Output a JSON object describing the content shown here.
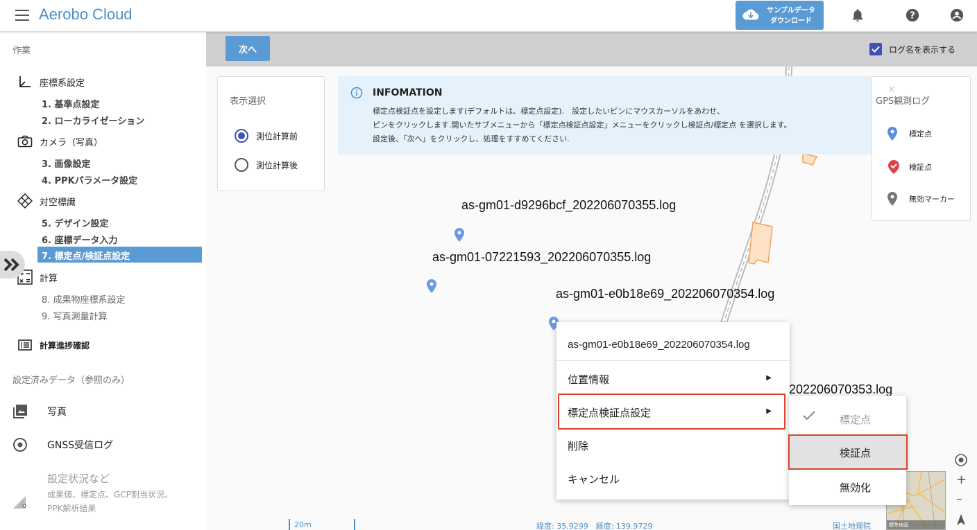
{
  "header": {
    "app_title": "Aerobo Cloud",
    "download_line1": "サンプルデータ",
    "download_line2": "ダウンロード"
  },
  "sidebar": {
    "work_label": "作業",
    "groups": [
      {
        "label": "座標系設定",
        "items": [
          "1. 基準点設定",
          "2. ローカライゼーション"
        ]
      },
      {
        "label": "カメラ（写真）",
        "items": [
          "3. 画像設定",
          "4. PPKパラメータ設定"
        ]
      },
      {
        "label": "対空標識",
        "items": [
          "5. デザイン設定",
          "6. 座標データ入力",
          "7. 標定点/検証点設定"
        ]
      },
      {
        "label": "計算",
        "items": [
          "8. 成果物座標系設定",
          "9. 写真測量計算"
        ]
      }
    ],
    "progress_label": "計算進捗確認",
    "ref_label": "設定済みデータ（参照のみ）",
    "ref_items": [
      "写真",
      "GNSS受信ログ"
    ],
    "status_title": "設定状況など",
    "status_sub1": "成果値、標定点、GCP割当状況、",
    "status_sub2": "PPK解析結果"
  },
  "toolbar": {
    "next_label": "次へ",
    "show_logname_label": "ログ名を表示する",
    "show_logname_checked": true
  },
  "display_select": {
    "title": "表示選択",
    "options": [
      "測位計算前",
      "測位計算後"
    ],
    "selected": "測位計算前"
  },
  "info": {
    "title": "INFOMATION",
    "lines": [
      "標定点検証点を設定します(デフォルトは、標定点設定).　設定したいピンにマウスカーソルをあわせ、",
      "ピンをクリックします.開いたサブメニューから「標定点検証点設定」メニューをクリックし検証点/標定点 を選択します。",
      "設定後、「次へ」をクリックし、処理をすすめてください."
    ]
  },
  "legend": {
    "title": "GPS観測ログ",
    "close": "×",
    "items": [
      {
        "label": "標定点",
        "color": "#5b8fd9"
      },
      {
        "label": "検証点",
        "color": "#e0404e"
      },
      {
        "label": "無効マーカー",
        "color": "#777777"
      }
    ]
  },
  "map": {
    "logs": [
      "as-gm01-d9296bcf_202206070355.log",
      "as-gm01-07221593_202206070355.log",
      "as-gm01-e0b18e69_202206070354.log",
      "202206070353.log"
    ],
    "scale": "20m",
    "coords": "緯度: 35.9299　経度: 139.9729",
    "attribution": "国土地理院",
    "minimap_label": "標準地図"
  },
  "context_menu": {
    "title": "as-gm01-e0b18e69_202206070354.log",
    "items": [
      "位置情報",
      "標定点検証点設定",
      "削除",
      "キャンセル"
    ],
    "arrow": "▶"
  },
  "submenu": {
    "items": [
      "標定点",
      "検証点",
      "無効化"
    ],
    "checked": "標定点",
    "hovered": "検証点"
  }
}
